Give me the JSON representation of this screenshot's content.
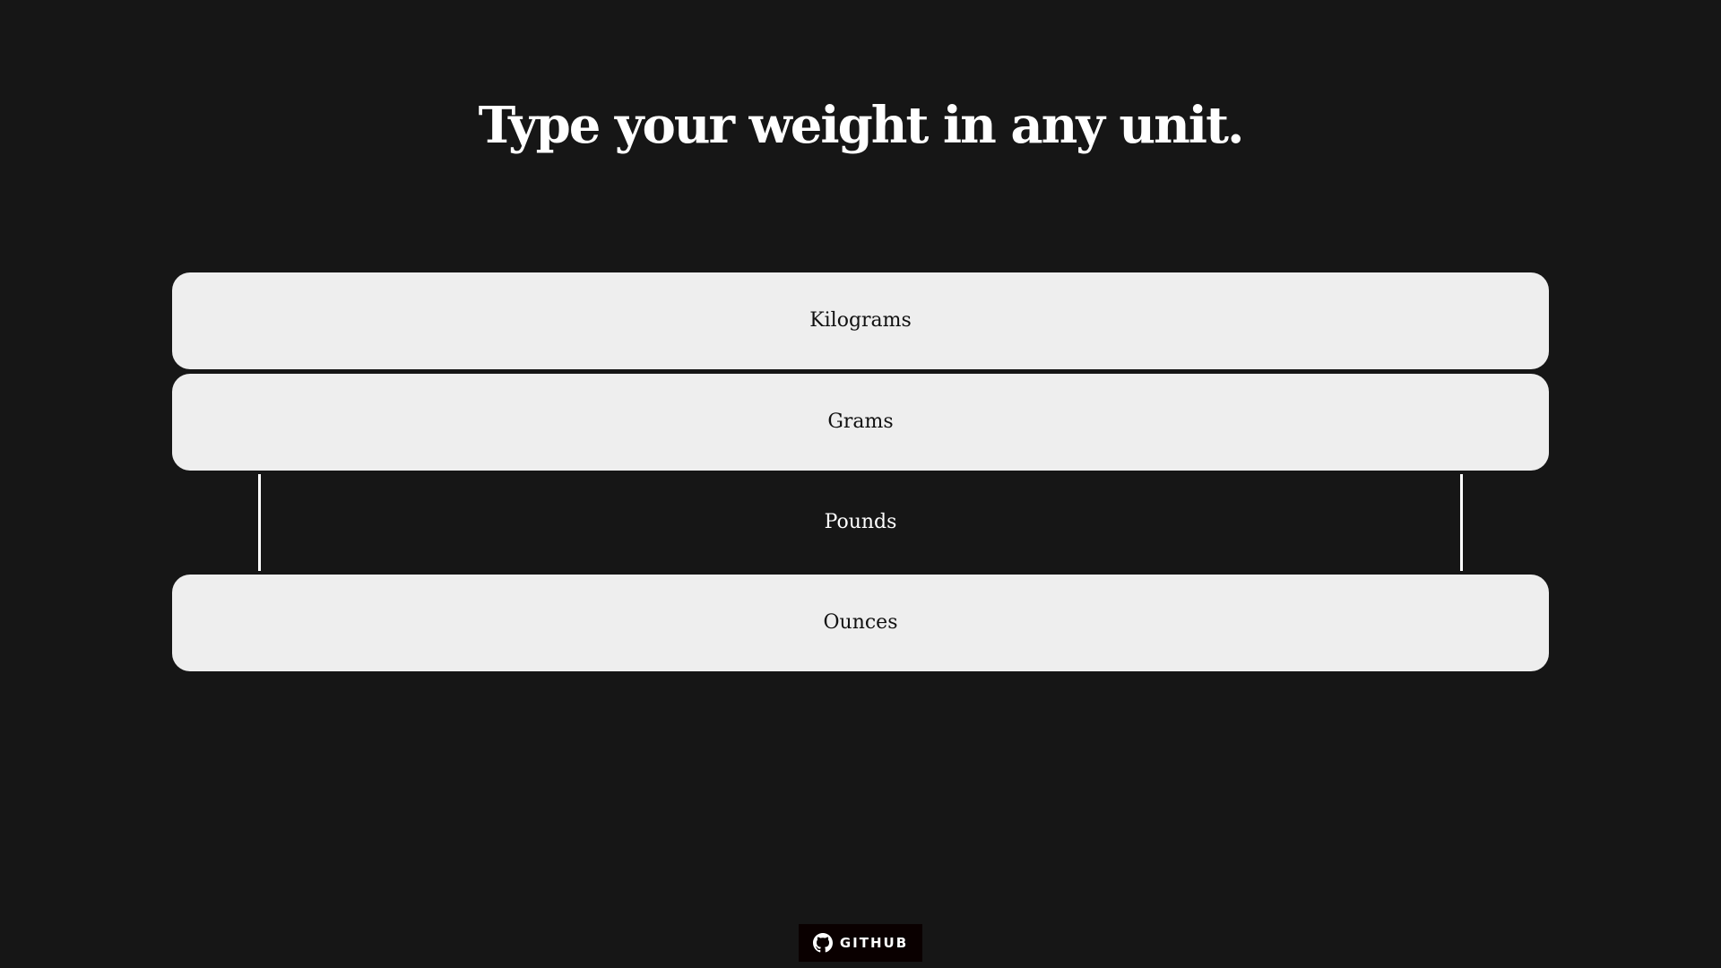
{
  "heading": "Type your weight in any unit.",
  "fields": [
    {
      "id": "kilograms",
      "placeholder": "Kilograms",
      "value": "",
      "focused": false
    },
    {
      "id": "grams",
      "placeholder": "Grams",
      "value": "",
      "focused": false
    },
    {
      "id": "pounds",
      "placeholder": "Pounds",
      "value": "",
      "focused": true
    },
    {
      "id": "ounces",
      "placeholder": "Ounces",
      "value": "",
      "focused": false
    }
  ],
  "footer": {
    "github_label": "GITHUB",
    "github_icon": "github-icon"
  },
  "colors": {
    "background": "#161616",
    "field_background": "#eeeeee",
    "text_on_dark": "#ffffff",
    "text_on_light": "#111111"
  }
}
